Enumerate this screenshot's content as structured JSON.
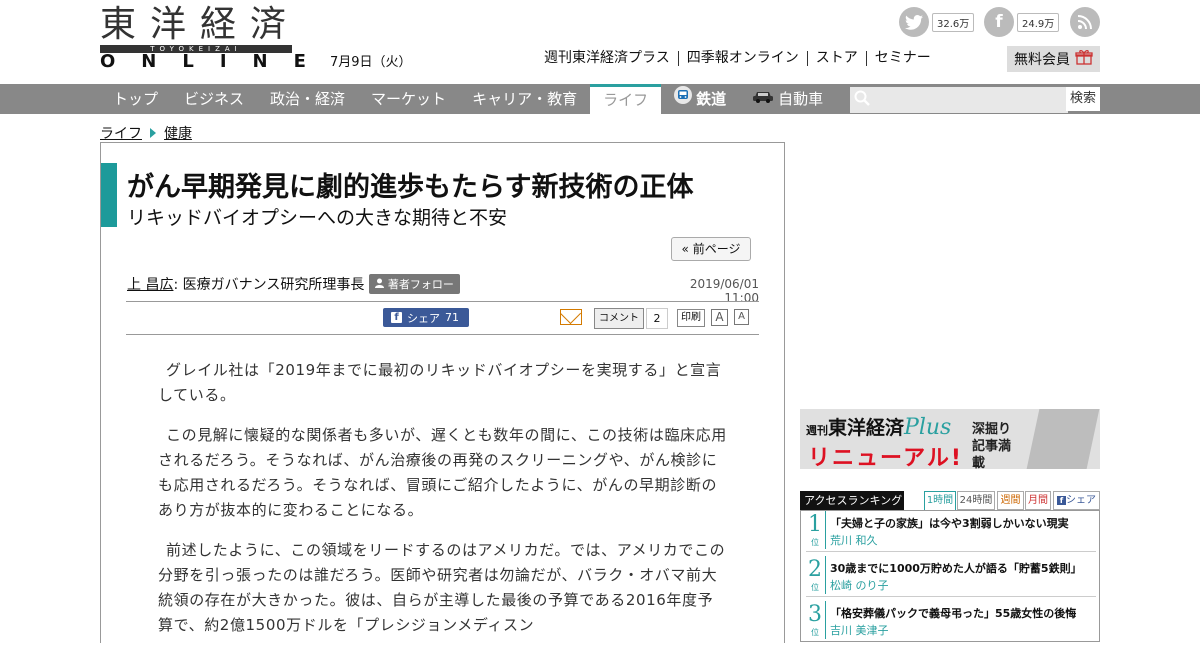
{
  "header": {
    "logo_kanji": "東洋経済",
    "logo_romaji": "TOYOKEIZAI",
    "logo_online": "ONLINE",
    "date": "7月9日（火）",
    "twitter_count": "32.6万",
    "facebook_count": "24.9万",
    "links": [
      "週刊東洋経済プラス",
      "四季報オンライン",
      "ストア",
      "セミナー"
    ],
    "member_label": "無料会員"
  },
  "nav": {
    "items": [
      "トップ",
      "ビジネス",
      "政治・経済",
      "マーケット",
      "キャリア・教育",
      "ライフ"
    ],
    "railway": "鉄道",
    "car": "自動車",
    "search_placeholder": "",
    "search_button": "検索"
  },
  "breadcrumb": [
    "ライフ",
    "健康"
  ],
  "article": {
    "title": "がん早期発見に劇的進歩もたらす新技術の正体",
    "subtitle": "リキッドバイオプシーへの大きな期待と不安",
    "prev_page": "« 前ページ",
    "author_name": "上 昌広",
    "author_role": ": 医療ガバナンス研究所理事長",
    "follow_label": "著者フォロー",
    "published": "2019/06/01 11:00",
    "share_label": "シェア",
    "share_count": "71",
    "comment_label": "コメント",
    "comment_count": "2",
    "print_label": "印刷",
    "font_large": "A",
    "font_small": "A",
    "paragraphs": [
      "グレイル社は「2019年までに最初のリキッドバイオプシーを実現する」と宣言している。",
      "この見解に懐疑的な関係者も多いが、遅くとも数年の間に、この技術は臨床応用されるだろう。そうなれば、がん治療後の再発のスクリーニングや、がん検診にも応用されるだろう。そうなれば、冒頭にご紹介したように、がんの早期診断のあり方が抜本的に変わることになる。",
      "前述したように、この領域をリードするのはアメリカだ。では、アメリカでこの分野を引っ張ったのは誰だろう。医師や研究者は勿論だが、バラク・オバマ前大統領の存在が大きかった。彼は、自らが主導した最後の予算である2016年度予算で、約2億1500万ドルを「プレシジョンメディスン"
    ]
  },
  "banner": {
    "line1_a": "週刊",
    "line1_b": "東洋経済",
    "line1_c": "Plus",
    "line2": "リニューアル!",
    "line3": "深掘り記事満載"
  },
  "ranking": {
    "title": "アクセスランキング",
    "tabs": [
      "1時間",
      "24時間",
      "週間",
      "月間",
      "シェア"
    ],
    "unit": "位",
    "items": [
      {
        "rank": "1",
        "title": "「夫婦と子の家族」は今や3割弱しかいない現実",
        "author": "荒川 和久"
      },
      {
        "rank": "2",
        "title": "30歳までに1000万貯めた人が語る「貯蓄5鉄則」",
        "author": "松崎 のり子"
      },
      {
        "rank": "3",
        "title": "「格安葬儀パックで義母弔った」55歳女性の後悔",
        "author": "吉川 美津子"
      }
    ]
  }
}
